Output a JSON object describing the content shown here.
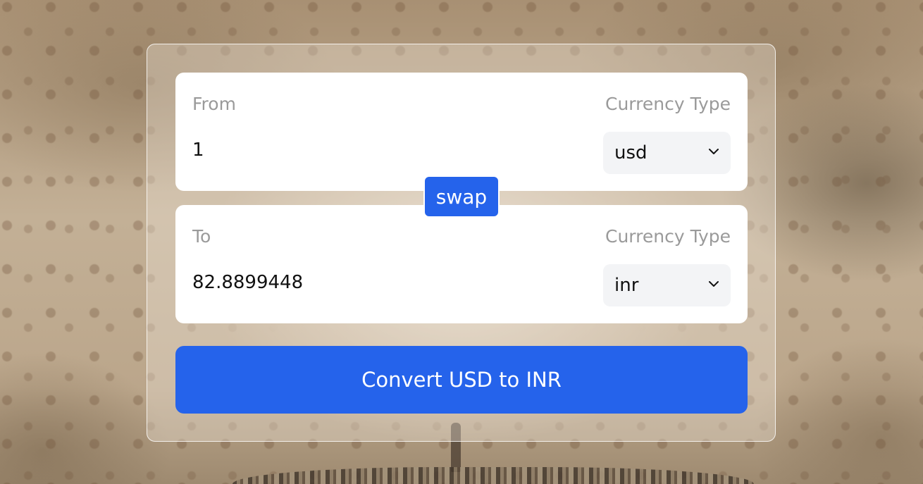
{
  "from_section": {
    "label": "From",
    "currency_label": "Currency Type",
    "amount_value": "1",
    "currency_selected": "usd"
  },
  "to_section": {
    "label": "To",
    "currency_label": "Currency Type",
    "amount_value": "82.8899448",
    "currency_selected": "inr"
  },
  "swap_label": "swap",
  "convert_label": "Convert USD to INR",
  "colors": {
    "accent": "#2563eb",
    "card": "#ffffff",
    "muted_text": "#9a9a9a",
    "select_bg": "#f3f4f6"
  },
  "icons": {
    "dropdown": "chevron-down-icon"
  }
}
